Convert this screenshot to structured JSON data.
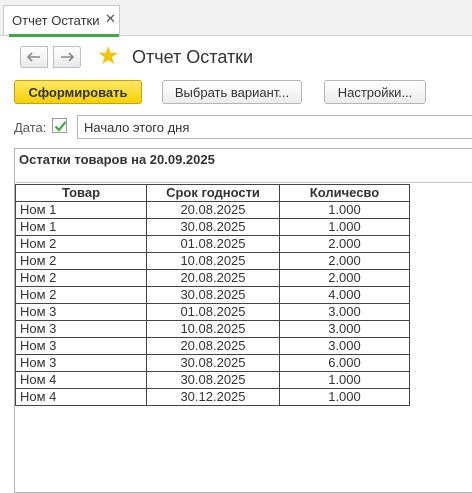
{
  "tab": {
    "label": "Отчет Остатки",
    "close": "✕"
  },
  "nav": {
    "back_icon": "arrow-left-icon",
    "forward_icon": "arrow-right-icon",
    "favorite_icon": "star-icon"
  },
  "page_title": "Отчет Остатки",
  "toolbar": {
    "generate_label": "Сформировать",
    "variant_label": "Выбрать вариант...",
    "settings_label": "Настройки..."
  },
  "filter": {
    "date_label": "Дата:",
    "date_checked": true,
    "date_value": "Начало этого дня"
  },
  "report": {
    "title": "Остатки товаров на 20.09.2025",
    "columns": [
      "Товар",
      "Срок годности",
      "Количесво"
    ],
    "rows": [
      [
        "Ном 1",
        "20.08.2025",
        "1.000"
      ],
      [
        "Ном 1",
        "30.08.2025",
        "1.000"
      ],
      [
        "Ном 2",
        "01.08.2025",
        "2.000"
      ],
      [
        "Ном 2",
        "10.08.2025",
        "2.000"
      ],
      [
        "Ном 2",
        "20.08.2025",
        "2.000"
      ],
      [
        "Ном 2",
        "30.08.2025",
        "4.000"
      ],
      [
        "Ном 3",
        "01.08.2025",
        "3.000"
      ],
      [
        "Ном 3",
        "10.08.2025",
        "3.000"
      ],
      [
        "Ном 3",
        "20.08.2025",
        "3.000"
      ],
      [
        "Ном 3",
        "30.08.2025",
        "6.000"
      ],
      [
        "Ном 4",
        "30.08.2025",
        "1.000"
      ],
      [
        "Ном 4",
        "30.12.2025",
        "1.000"
      ]
    ]
  },
  "colors": {
    "accent": "#3fa84d",
    "primary_button": "#f5d100",
    "star": "#f4c400"
  }
}
